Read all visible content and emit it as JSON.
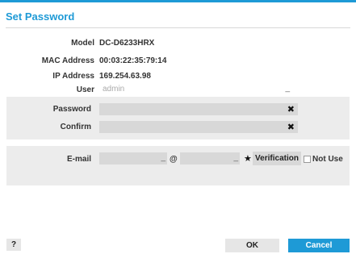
{
  "dialog": {
    "title": "Set Password"
  },
  "info": {
    "model_label": "Model",
    "model_value": "DC-D6233HRX",
    "mac_label": "MAC Address",
    "mac_value": "00:03:22:35:79:14",
    "ip_label": "IP Address",
    "ip_value": "169.254.63.98",
    "user_label": "User",
    "user_placeholder": "admin"
  },
  "password": {
    "password_label": "Password",
    "confirm_label": "Confirm"
  },
  "email": {
    "label": "E-mail",
    "at_symbol": "@",
    "verification_label": "Verification",
    "not_use_label": "Not Use",
    "not_use_checked": false
  },
  "footer": {
    "help_label": "?",
    "ok_label": "OK",
    "cancel_label": "Cancel"
  },
  "colors": {
    "accent": "#1e9ad6",
    "panel": "#ececec",
    "field": "#d8d8d8"
  },
  "icons": {
    "clear": "close-icon",
    "domain_picker": "star-icon"
  }
}
